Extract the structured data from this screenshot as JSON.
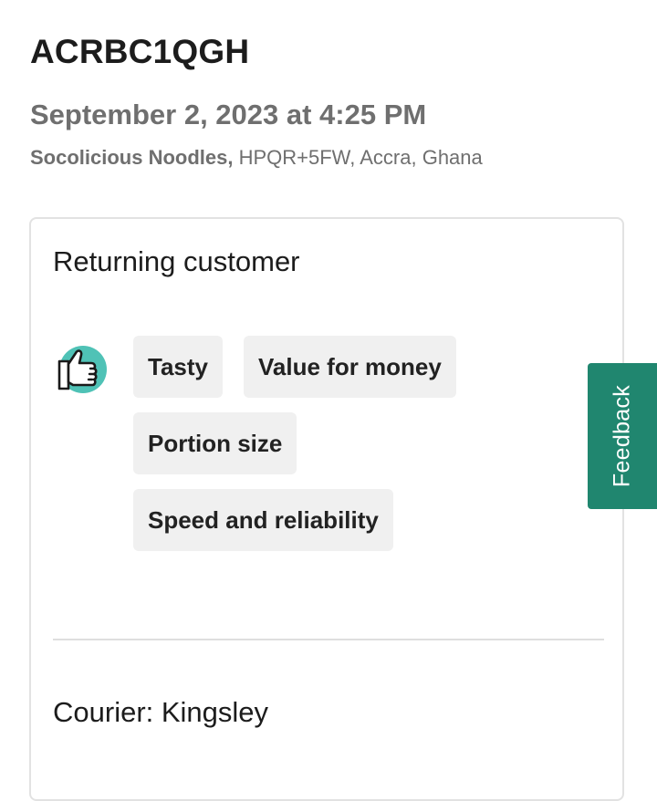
{
  "order": {
    "id": "ACRBC1QGH",
    "date": "September 2, 2023 at 4:25 PM",
    "restaurant": "Socolicious Noodles,",
    "address": " HPQR+5FW, Accra, Ghana"
  },
  "review": {
    "title": "Returning customer",
    "rating_icon": "thumbs-up-icon",
    "tags": [
      "Tasty",
      "Value for money",
      "Portion size",
      "Speed and reliability"
    ],
    "courier": "Courier: Kingsley"
  },
  "feedback_tab": {
    "label": "Feedback"
  },
  "colors": {
    "accent": "#20866f",
    "thumb_circle": "#4fc2b6",
    "tag_bg": "#f0f0f0",
    "muted_text": "#6f6f6f"
  }
}
